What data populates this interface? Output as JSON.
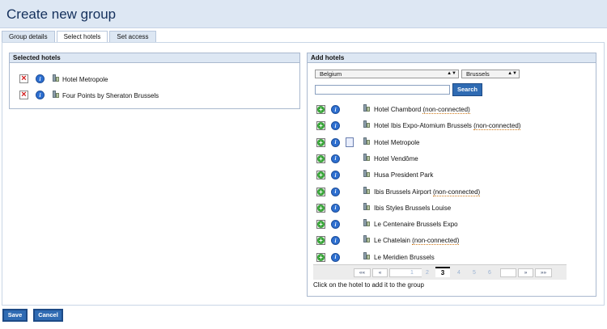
{
  "page": {
    "title": "Create new group"
  },
  "tabs": [
    {
      "label": "Group details"
    },
    {
      "label": "Select hotels"
    },
    {
      "label": "Set access"
    }
  ],
  "selected_panel": {
    "title": "Selected hotels",
    "hotels": [
      {
        "name": "Hotel Metropole"
      },
      {
        "name": "Four Points by Sheraton Brussels"
      }
    ]
  },
  "add_panel": {
    "title": "Add hotels",
    "country_select": "Belgium",
    "city_select": "Brussels",
    "search_value": "",
    "search_button": "Search",
    "non_connected_label": "(non-connected)",
    "hotels": [
      {
        "name": "Hotel Chambord",
        "non_connected": true,
        "note": false
      },
      {
        "name": "Hotel Ibis Expo-Atomium Brussels",
        "non_connected": true,
        "note": false
      },
      {
        "name": "Hotel Metropole",
        "non_connected": false,
        "note": true
      },
      {
        "name": "Hotel Vendôme",
        "non_connected": false,
        "note": false
      },
      {
        "name": "Husa President Park",
        "non_connected": false,
        "note": false
      },
      {
        "name": "Ibis Brussels Airport",
        "non_connected": true,
        "note": false
      },
      {
        "name": "Ibis Styles Brussels Louise",
        "non_connected": false,
        "note": false
      },
      {
        "name": "Le Centenaire Brussels Expo",
        "non_connected": false,
        "note": false
      },
      {
        "name": "Le Chatelain",
        "non_connected": true,
        "note": false
      },
      {
        "name": "Le Meridien Brussels",
        "non_connected": false,
        "note": false
      }
    ],
    "pager": {
      "first": "««",
      "prev": "«",
      "next": "»",
      "last": "»»",
      "pages": [
        "1",
        "2",
        "3",
        "4",
        "5",
        "6"
      ],
      "current": "3"
    },
    "hint": "Click on the hotel to add it to the group"
  },
  "buttons": {
    "save": "Save",
    "cancel": "Cancel"
  },
  "icons": {
    "delete": "delete-x-icon",
    "info": "info-icon",
    "add": "add-plus-icon",
    "hotel": "hotel-building-icon",
    "note": "note-icon"
  },
  "colors": {
    "header_bg": "#dde7f3",
    "title": "#14305c",
    "button_bg": "#2f6bb3",
    "non_connected_underline": "#d07a1a"
  }
}
